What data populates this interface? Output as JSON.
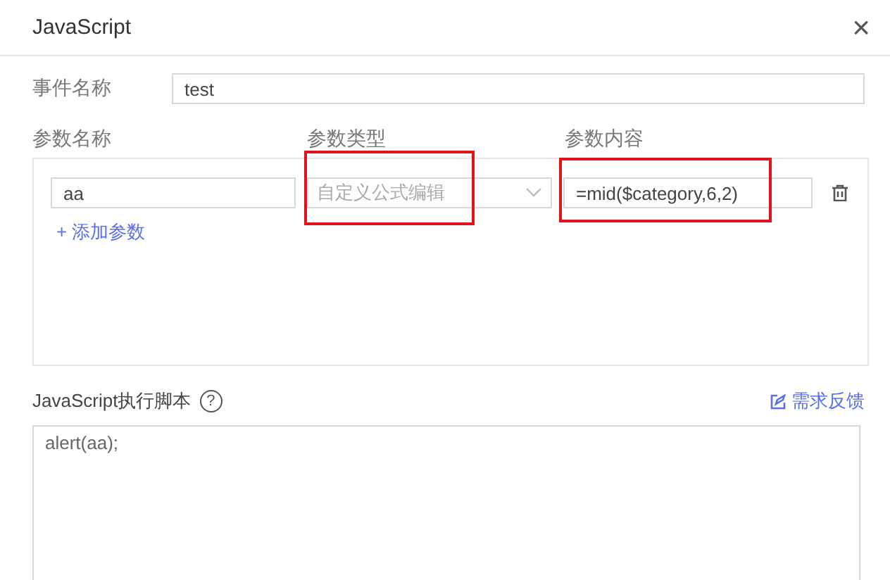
{
  "window": {
    "title": "JavaScript",
    "close": "×"
  },
  "event_name": {
    "label": "事件名称",
    "value": "test"
  },
  "params": {
    "columns": [
      "参数名称",
      "参数类型",
      "参数内容"
    ],
    "rows": [
      {
        "name": "aa",
        "type_placeholder": "自定义公式编辑",
        "type_highlighted": true,
        "content": "=mid($category,6,2)",
        "content_highlighted": true
      }
    ],
    "add": "+ 添加参数"
  },
  "script": {
    "label": "JavaScript执行脚本",
    "help": "?",
    "feedback": "需求反馈",
    "value": "alert(aa);"
  }
}
